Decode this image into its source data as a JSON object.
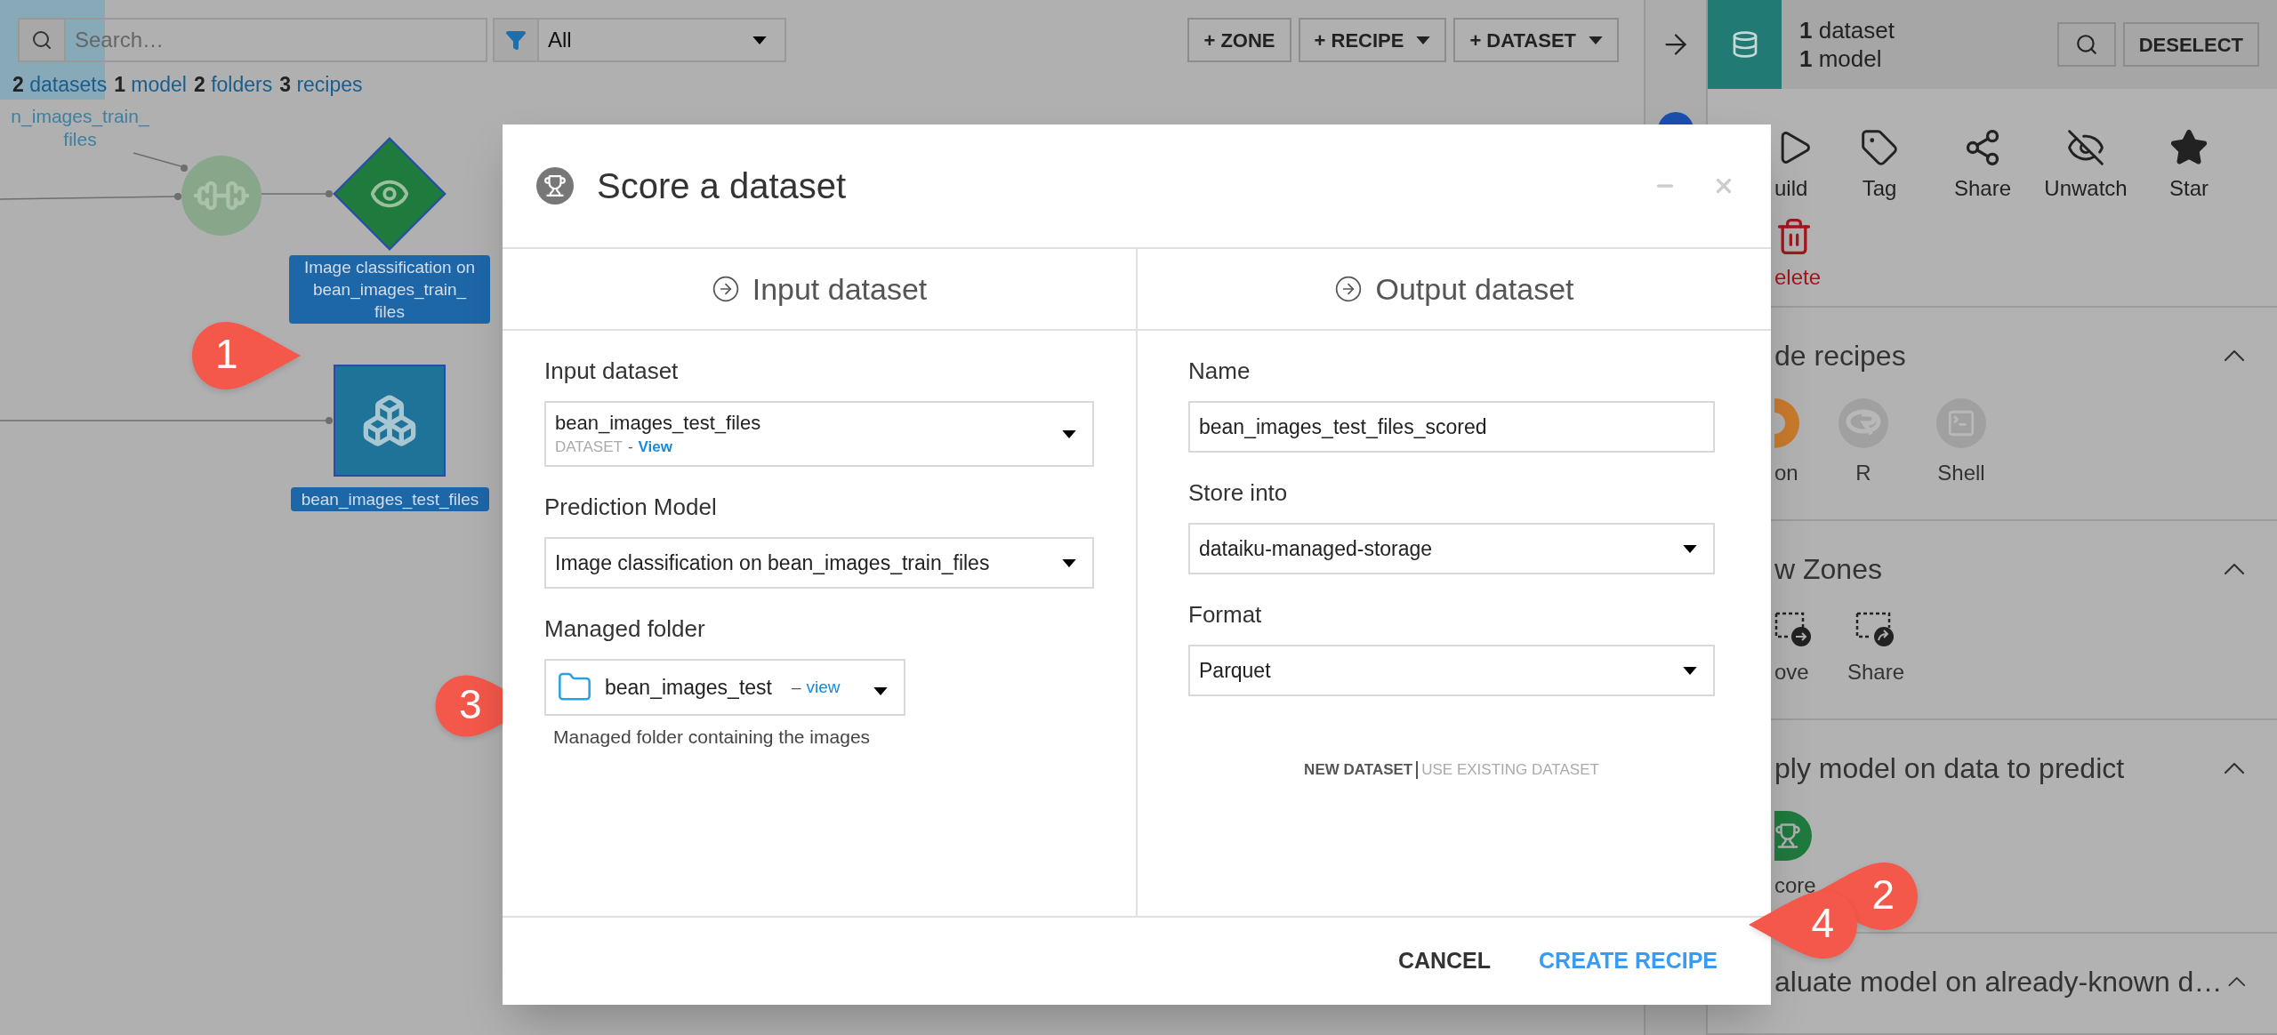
{
  "toolbar": {
    "search": {
      "placeholder": "Search…"
    },
    "filter": {
      "value": "All"
    },
    "buttons": [
      {
        "label": "+ ZONE",
        "dropdown": false
      },
      {
        "label": "+ RECIPE",
        "dropdown": true
      },
      {
        "label": "+ DATASET",
        "dropdown": true
      }
    ]
  },
  "counts": [
    "**2** datasets",
    "**1** model",
    "**2** folders",
    "**3** recipes"
  ],
  "flow": {
    "faded_dataset_label": "n_images_train_\nfiles",
    "model_label": "Image classification on\nbean_images_train_\nfiles",
    "dataset_label": "bean_images_test_files"
  },
  "right_panel": {
    "selection": [
      "**1** dataset",
      "**1** model"
    ],
    "deselect": "DESELECT",
    "actions": [
      {
        "label": "uild",
        "kind": "build"
      },
      {
        "label": "Tag",
        "kind": "tag"
      },
      {
        "label": "Share",
        "kind": "share"
      },
      {
        "label": "Unwatch",
        "kind": "unwatch"
      },
      {
        "label": "Star",
        "kind": "star"
      },
      {
        "label": "elete",
        "kind": "delete"
      }
    ],
    "sections": [
      {
        "title": "de recipes",
        "items": [
          {
            "label": "on",
            "kind": "python"
          },
          {
            "label": "R",
            "kind": "r"
          },
          {
            "label": "Shell",
            "kind": "shell"
          }
        ]
      },
      {
        "title": "w Zones",
        "items": [
          {
            "label": "ove",
            "kind": "move"
          },
          {
            "label": "Share",
            "kind": "zone-share"
          }
        ]
      },
      {
        "title": "ply model on data to predict",
        "items": [
          {
            "label": "core",
            "kind": "score"
          }
        ]
      },
      {
        "title": "aluate model on already-known d…"
      }
    ]
  },
  "dialog": {
    "title": "Score a dataset",
    "columns": [
      {
        "heading": "Input dataset",
        "fields": [
          {
            "kind": "dataset-select",
            "label": "Input dataset",
            "value": "bean_images_test_files",
            "sub": "DATASET",
            "sep": "-",
            "link": "View"
          },
          {
            "kind": "select",
            "label": "Prediction Model",
            "value": "Image classification on bean_images_train_files"
          },
          {
            "kind": "folder-select",
            "label": "Managed folder",
            "value": "bean_images_test",
            "sep": "–",
            "link": "view",
            "help": "Managed folder containing the images"
          }
        ]
      },
      {
        "heading": "Output dataset",
        "fields": [
          {
            "kind": "text",
            "label": "Name",
            "value": "bean_images_test_files_scored"
          },
          {
            "kind": "select",
            "label": "Store into",
            "value": "dataiku-managed-storage"
          },
          {
            "kind": "select",
            "label": "Format",
            "value": "Parquet"
          }
        ],
        "modes": [
          {
            "label": "NEW DATASET",
            "selected": true
          },
          {
            "label": "USE EXISTING DATASET",
            "selected": false
          }
        ]
      }
    ],
    "buttons": [
      {
        "label": "CANCEL",
        "kind": "secondary"
      },
      {
        "label": "CREATE RECIPE",
        "kind": "primary"
      }
    ]
  },
  "callouts": [
    {
      "label": "1"
    },
    {
      "label": "2"
    },
    {
      "label": "3"
    },
    {
      "label": "4"
    }
  ]
}
